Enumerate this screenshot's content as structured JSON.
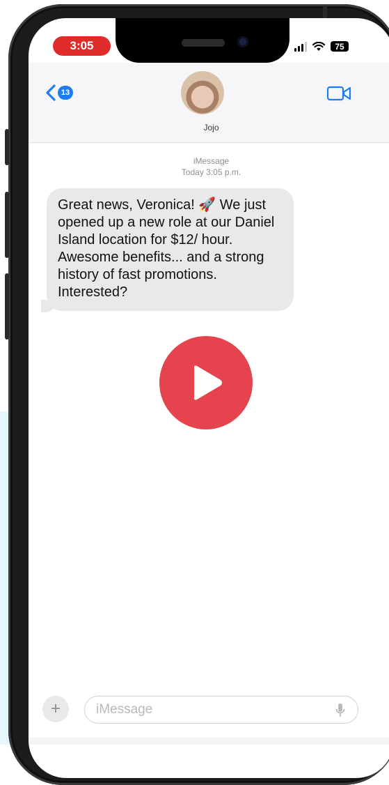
{
  "status_bar": {
    "time": "3:05",
    "battery": "75"
  },
  "header": {
    "unread_count": "13",
    "contact_name": "Jojo"
  },
  "thread": {
    "service": "iMessage",
    "timestamp": "Today 3:05 p.m.",
    "messages": [
      {
        "text": "Great news, Veronica! 🚀 We just opened up a new role at our Daniel Island location for $12/ hour. Awesome benefits... and a strong history of fast promotions. Interested?"
      }
    ]
  },
  "compose": {
    "placeholder": "iMessage"
  },
  "icons": {
    "back": "chevron-left-icon",
    "video": "video-camera-icon",
    "play": "play-icon",
    "add": "plus-icon",
    "mic": "microphone-icon"
  },
  "colors": {
    "accent": "#1e7cf2",
    "time_pill": "#e02b2b",
    "play_button": "#e5434d",
    "bubble": "#e9e9eb"
  }
}
